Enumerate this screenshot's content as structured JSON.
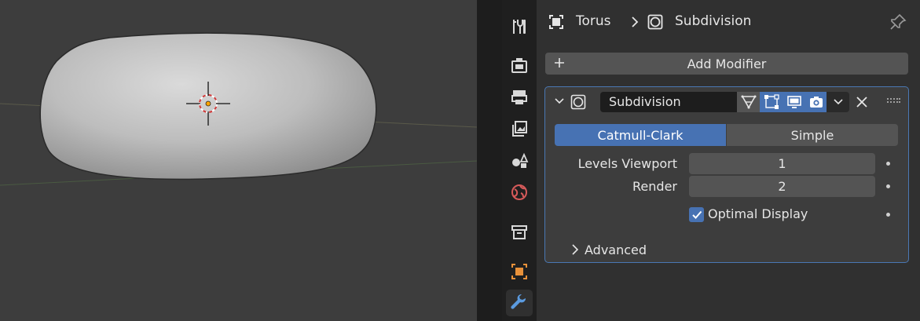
{
  "viewport": {
    "background": "#3d3d3d",
    "object_color": "#b8b8b8"
  },
  "tabs": [
    {
      "name": "tool-tab",
      "icon": "tool-icon",
      "active": false
    },
    {
      "name": "render-tab",
      "icon": "render-icon",
      "active": false
    },
    {
      "name": "output-tab",
      "icon": "output-icon",
      "active": false
    },
    {
      "name": "view-layer-tab",
      "icon": "view-layer-icon",
      "active": false
    },
    {
      "name": "scene-tab",
      "icon": "scene-icon",
      "active": false
    },
    {
      "name": "world-tab",
      "icon": "world-icon",
      "active": false
    },
    {
      "name": "collection-tab",
      "icon": "collection-icon",
      "active": false
    },
    {
      "name": "object-tab",
      "icon": "object-icon",
      "active": false
    },
    {
      "name": "modifier-tab",
      "icon": "wrench-icon",
      "active": true
    }
  ],
  "header": {
    "object_name": "Torus",
    "modifier_name": "Subdivision"
  },
  "add_modifier_label": "Add Modifier",
  "modifier": {
    "name": "Subdivision",
    "accent": "#4772b3",
    "mode_options": [
      "Catmull-Clark",
      "Simple"
    ],
    "selected_mode": "Catmull-Clark",
    "levels_viewport_label": "Levels Viewport",
    "levels_viewport_value": "1",
    "render_label": "Render",
    "render_value": "2",
    "optimal_display_label": "Optimal Display",
    "optimal_display_checked": true,
    "advanced_label": "Advanced"
  }
}
